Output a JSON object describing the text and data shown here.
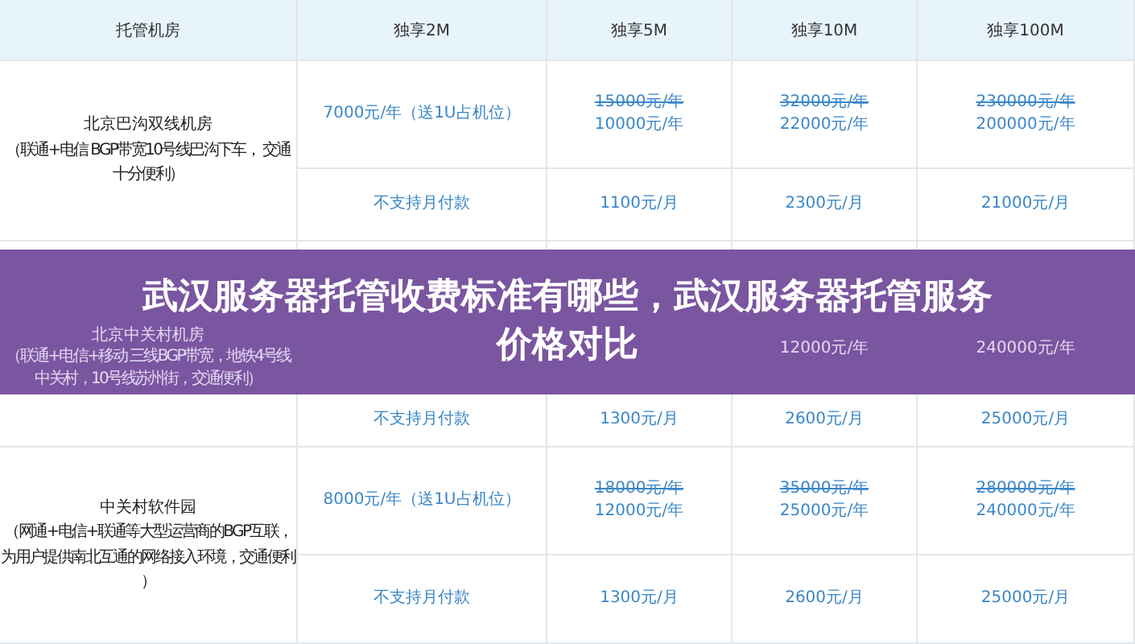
{
  "table": {
    "columns": [
      "托管机房",
      "独享2M",
      "独享5M",
      "独享10M",
      "独享100M"
    ],
    "rooms": [
      {
        "name_lines": [
          "北京巴沟双线机房",
          "（联通+电信 BGP带宽10号线巴沟下车， 交通",
          "十分便利）"
        ],
        "yearly": [
          {
            "kind": "plain",
            "text": "7000元/年（送1U占机位）"
          },
          {
            "kind": "discount",
            "old": "15000元/年",
            "new": "10000元/年"
          },
          {
            "kind": "discount",
            "old": "32000元/年",
            "new": "22000元/年"
          },
          {
            "kind": "discount",
            "old": "230000元/年",
            "new": "200000元/年"
          }
        ],
        "monthly": [
          "不支持月付款",
          "1100元/月",
          "2300元/月",
          "21000元/月"
        ]
      },
      {
        "covered": true,
        "name_lines": [
          "北京中关村机房",
          "（联通+电信+移动 三线BGP带宽，地铁4号线",
          "中关村，10号线苏州街，交通便利）"
        ],
        "yearly": [
          {
            "kind": "empty"
          },
          {
            "kind": "empty"
          },
          {
            "kind": "plain",
            "text": "12000元/年"
          },
          {
            "kind": "plain",
            "text": "240000元/年"
          }
        ],
        "monthly": [
          "不支持月付款",
          "1300元/月",
          "2600元/月",
          "25000元/月"
        ]
      },
      {
        "name_lines": [
          "中关村软件园",
          "（网通+电信+联通等大型运营商的BGP互联，",
          "为用户提供南北互通的网络接入环境，交通便利",
          "）"
        ],
        "yearly": [
          {
            "kind": "plain",
            "text": "8000元/年（送1U占机位）"
          },
          {
            "kind": "discount",
            "old": "18000元/年",
            "new": "12000元/年"
          },
          {
            "kind": "discount",
            "old": "35000元/年",
            "new": "25000元/年"
          },
          {
            "kind": "discount",
            "old": "280000元/年",
            "new": "240000元/年"
          }
        ],
        "monthly": [
          "不支持月付款",
          "1300元/月",
          "2600元/月",
          "25000元/月"
        ]
      }
    ]
  },
  "banner": {
    "lines": [
      "武汉服务器托管收费标准有哪些，武汉服务器托管服务",
      "价格对比"
    ]
  }
}
